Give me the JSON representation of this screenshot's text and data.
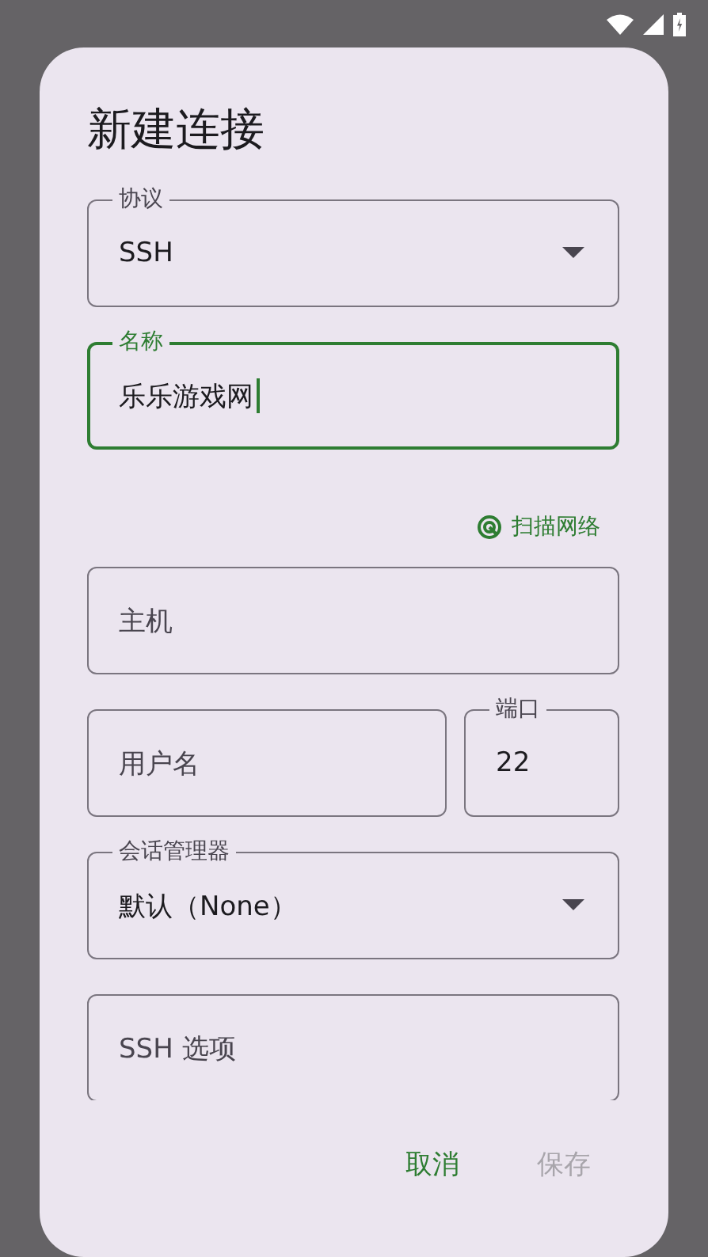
{
  "dialog": {
    "title": "新建连接",
    "items": [
      {
        "kind": "dropdown",
        "label": "协议",
        "value": "SSH",
        "focused": false
      },
      {
        "kind": "text",
        "label": "名称",
        "value": "乐乐游戏网",
        "focused": true
      },
      {
        "kind": "link",
        "label": "扫描网络"
      },
      {
        "kind": "text",
        "label": "主机",
        "focused": false
      },
      {
        "kind": "row",
        "fields": [
          {
            "kind": "text",
            "label": "用户名",
            "focused": false
          },
          {
            "kind": "text",
            "label": "端口",
            "value": "22",
            "focused": false
          }
        ]
      },
      {
        "kind": "dropdown",
        "label": "会话管理器",
        "value": "默认（None）",
        "focused": false
      },
      {
        "kind": "text",
        "label": "SSH 选项",
        "focused": false
      }
    ],
    "buttons": [
      {
        "label": "取消",
        "disabled": false
      },
      {
        "label": "保存",
        "disabled": true
      }
    ]
  }
}
